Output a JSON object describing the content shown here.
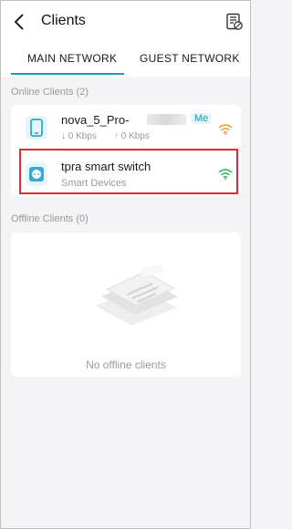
{
  "header": {
    "title": "Clients",
    "back_icon": "chevron-left-icon",
    "filter_icon": "list-settings-icon"
  },
  "tabs": [
    {
      "label": "MAIN NETWORK",
      "active": true
    },
    {
      "label": "GUEST NETWORK",
      "active": false
    }
  ],
  "online": {
    "label": "Online Clients (2)",
    "clients": [
      {
        "name": "nova_5_Pro-",
        "badge": "Me",
        "icon": "phone-icon",
        "download": "0 Kbps",
        "upload": "0 Kbps",
        "signal_color": "#e8a63a"
      },
      {
        "name": "tpra smart switch",
        "subtitle": "Smart Devices",
        "icon": "smart-plug-icon",
        "signal_color": "#3fb86b"
      }
    ]
  },
  "offline": {
    "label": "Offline Clients (0)",
    "empty_text": "No offline clients"
  },
  "colors": {
    "accent": "#0f9fbf",
    "highlight": "#e02b36"
  }
}
